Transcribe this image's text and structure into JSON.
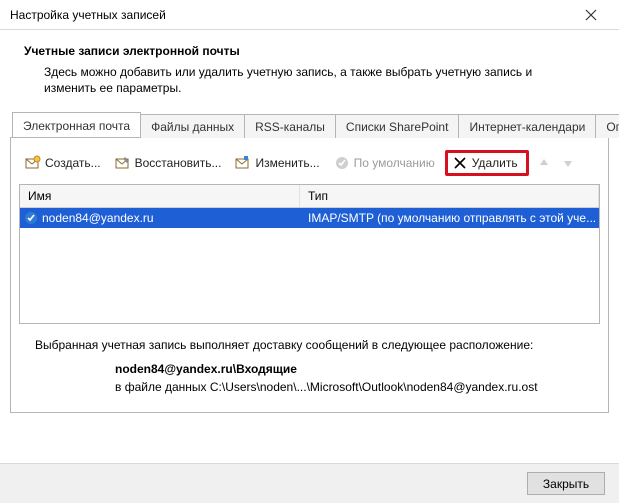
{
  "window": {
    "title": "Настройка учетных записей"
  },
  "header": {
    "title": "Учетные записи электронной почты",
    "description": "Здесь можно добавить или удалить учетную запись, а также выбрать учетную запись и изменить ее параметры."
  },
  "tabs": {
    "items": [
      "Электронная почта",
      "Файлы данных",
      "RSS-каналы",
      "Списки SharePoint",
      "Интернет-календари",
      "Опублико"
    ],
    "active_index": 0
  },
  "toolbar": {
    "create": "Создать...",
    "repair": "Восстановить...",
    "change": "Изменить...",
    "default": "По умолчанию",
    "delete": "Удалить"
  },
  "list": {
    "columns": {
      "name": "Имя",
      "type": "Тип"
    },
    "rows": [
      {
        "name": "noden84@yandex.ru",
        "type": "IMAP/SMTP (по умолчанию отправлять с этой уче..."
      }
    ]
  },
  "delivery": {
    "intro": "Выбранная учетная запись выполняет доставку сообщений в следующее расположение:",
    "target": "noden84@yandex.ru\\Входящие",
    "path": "в файле данных C:\\Users\\noden\\...\\Microsoft\\Outlook\\noden84@yandex.ru.ost"
  },
  "footer": {
    "close": "Закрыть"
  }
}
